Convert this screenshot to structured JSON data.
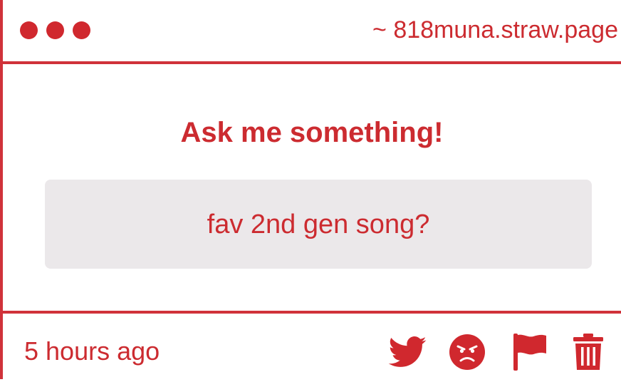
{
  "window": {
    "url": "~ 818muna.straw.page"
  },
  "main": {
    "heading": "Ask me something!",
    "question": "fav 2nd gen song?"
  },
  "footer": {
    "timestamp": "5 hours ago",
    "actions": [
      {
        "icon": "twitter-icon"
      },
      {
        "icon": "angry-face-icon"
      },
      {
        "icon": "flag-icon"
      },
      {
        "icon": "trash-icon"
      }
    ]
  },
  "colors": {
    "accent": "#cc2b30",
    "border": "#d0323a",
    "question_bg": "#ebe8ea",
    "background": "#ffffff"
  }
}
